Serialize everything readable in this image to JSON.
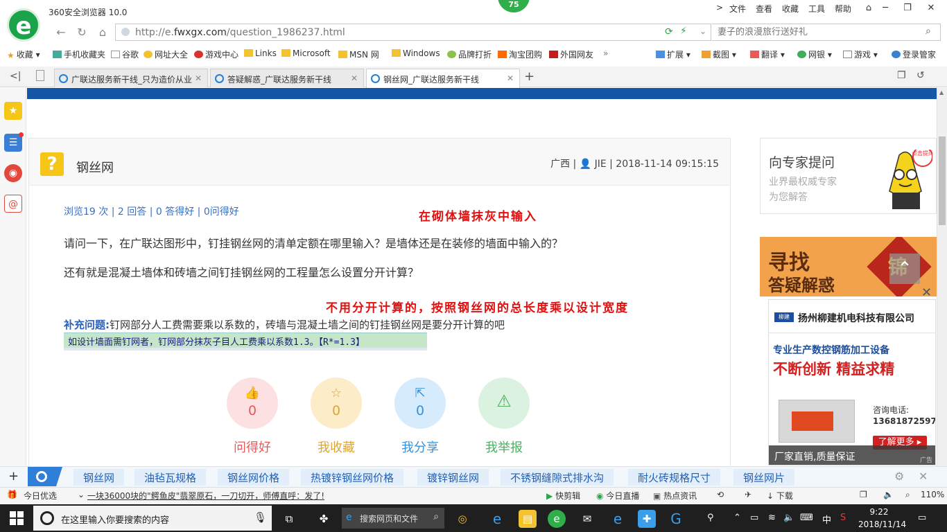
{
  "browser": {
    "title": "360安全浏览器 10.0",
    "badge": "75",
    "menu": [
      "文件",
      "查看",
      "收藏",
      "工具",
      "帮助"
    ],
    "url_prefix": "http://e.",
    "url_domain": "fwxgx.com",
    "url_path": "/question_1986237.html",
    "search_placeholder": "妻子的浪漫旅行送好礼"
  },
  "bookmarks": [
    "收藏",
    "手机收藏夹",
    "谷歌",
    "网址大全",
    "游戏中心",
    "Links",
    "Microsoft",
    "MSN 网",
    "Windows",
    "品牌打折",
    "淘宝团购",
    "外国网友"
  ],
  "toolbar_right": [
    "扩展",
    "截图",
    "翻译",
    "网银",
    "游戏",
    "登录管家"
  ],
  "tabs": [
    {
      "label": "广联达服务新干线_只为造价从业"
    },
    {
      "label": "答疑解惑_广联达服务新干线"
    },
    {
      "label": "钢丝网_广联达服务新干线"
    }
  ],
  "question": {
    "title": "钢丝网",
    "meta": "广西 | 👤 JIE | 2018-11-14 09:15:15",
    "stats": "浏览19 次 | 2 回答 | 0 答得好 | 0问得好",
    "annotation1": "在砌体墙抹灰中输入",
    "para1": "请问一下，在广联达图形中，钉挂钢丝网的清单定额在哪里输入？是墙体还是在装修的墙面中输入的？",
    "para2": "还有就是混凝土墙体和砖墙之间钉挂钢丝网的工程量怎么设置分开计算？",
    "annotation2": "不用分开计算的，按照钢丝网的总长度乘以设计宽度",
    "suppl_label": "补充问题:",
    "suppl_text": "钉网部分人工费需要乘以系数的，砖墙与混凝土墙之间的钉挂钢丝网是要分开计算的吧",
    "ocr_text": "如设计墙面需钉网者，钉网部分抹灰子目人工费乘以系数1.3。【R*=1.3】"
  },
  "actions": [
    {
      "label": "问得好",
      "count": "0",
      "color": "#e25a5a"
    },
    {
      "label": "我收藏",
      "count": "0",
      "color": "#d9a53a"
    },
    {
      "label": "我分享",
      "count": "0",
      "color": "#3a8fd9"
    },
    {
      "label": "我举报",
      "count": "",
      "color": "#4caf63"
    }
  ],
  "expert": {
    "title": "向专家提问",
    "sub1": "业界最权威专家",
    "sub2": "为您解答",
    "bubble": "点击提问"
  },
  "banner": {
    "line1": "寻找",
    "line2": "答疑解惑",
    "seal": "锦"
  },
  "ad": {
    "logo": "柳建",
    "company": "扬州柳建机电科技有限公司",
    "slogan1": "专业生产数控钢筋加工设备",
    "slogan2": "不断创新 精益求精",
    "phone_label": "咨询电话:",
    "phone": "13681872597",
    "more": "了解更多 ▸",
    "footer": "厂家直销,质量保证",
    "tag": "广告"
  },
  "related_tags": [
    "钢丝网",
    "油毡瓦规格",
    "钢丝网价格",
    "热镀锌钢丝网价格",
    "镀锌钢丝网",
    "不锈钢缝隙式排水沟",
    "耐火砖规格尺寸",
    "钢丝网片"
  ],
  "statusbar": {
    "left": "今日优选",
    "news": "一块36000块的\"鳄鱼皮\"翡翠原石，一刀切开，师傅直呼：发了!",
    "items": [
      "快剪辑",
      "今日直播",
      "热点资讯",
      "下载"
    ],
    "zoom": "110%"
  },
  "taskbar": {
    "search_placeholder": "在这里输入你要搜索的内容",
    "web_search": "搜索网页和文件",
    "time": "9:22",
    "date": "2018/11/14",
    "ime": "中"
  }
}
